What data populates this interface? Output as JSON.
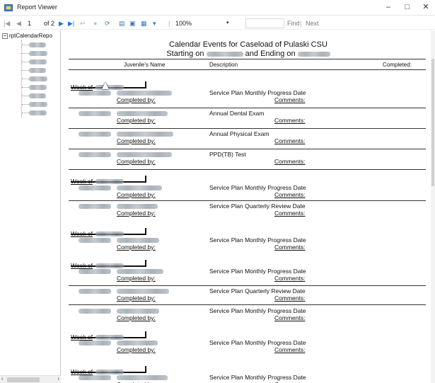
{
  "window": {
    "title": "Report Viewer",
    "minimize": "–",
    "maximize": "□",
    "close": "✕"
  },
  "toolbar": {
    "page_current": "1",
    "page_of": "of 2",
    "zoom": "100%",
    "find": "Find",
    "separator": "|",
    "next": "Next"
  },
  "tree": {
    "root_label": "rptCalendarRepo"
  },
  "report": {
    "title_line1": "Calendar Events for Caseload of  Pulaski CSU",
    "title_line2_prefix": "Starting on",
    "title_line2_mid": "and Ending on",
    "col_name": "Juvenile's Name",
    "col_desc": "Description",
    "col_completed": "Completed:",
    "week_label": "Week of",
    "completed_by": "Completed by:",
    "comments": "Comments:",
    "events": [
      {
        "desc": "Service Plan Monthly Progress Date"
      },
      {
        "desc": "Annual Dental Exam"
      },
      {
        "desc": "Annual Physical Exam"
      },
      {
        "desc": "PPD(TB) Test"
      },
      {
        "desc": "Service Plan Monthly Progress Date"
      },
      {
        "desc": "Service Plan Quarterly Review Date"
      },
      {
        "desc": "Service Plan Monthly Progress Date"
      },
      {
        "desc": "Service Plan Monthly Progress Date"
      },
      {
        "desc": "Service Plan Quarterly Review Date"
      },
      {
        "desc": "Service Plan Monthly Progress Date"
      },
      {
        "desc": "Service Plan Monthly Progress Date"
      },
      {
        "desc": "Service Plan Monthly Progress Date"
      }
    ]
  },
  "icons": [
    "first-page-icon",
    "prev-page-icon",
    "next-page-icon",
    "last-page-icon",
    "back-icon",
    "stop-icon",
    "refresh-icon",
    "print-icon",
    "print-layout-icon",
    "page-setup-icon",
    "export-icon"
  ]
}
